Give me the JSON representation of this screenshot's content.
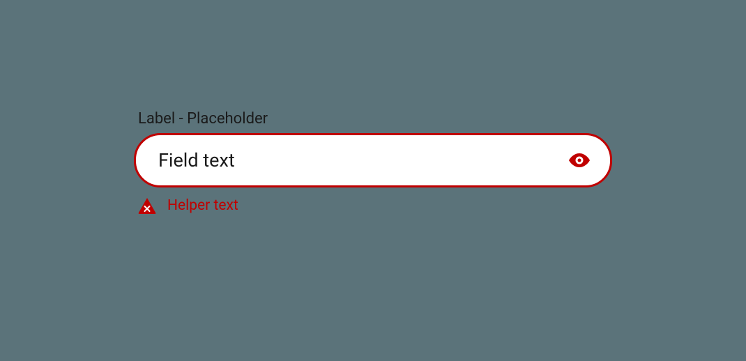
{
  "field": {
    "label": "Label - Placeholder",
    "value": "Field text",
    "helper": "Helper text"
  },
  "colors": {
    "error": "#c00000",
    "background": "#5b737a"
  }
}
